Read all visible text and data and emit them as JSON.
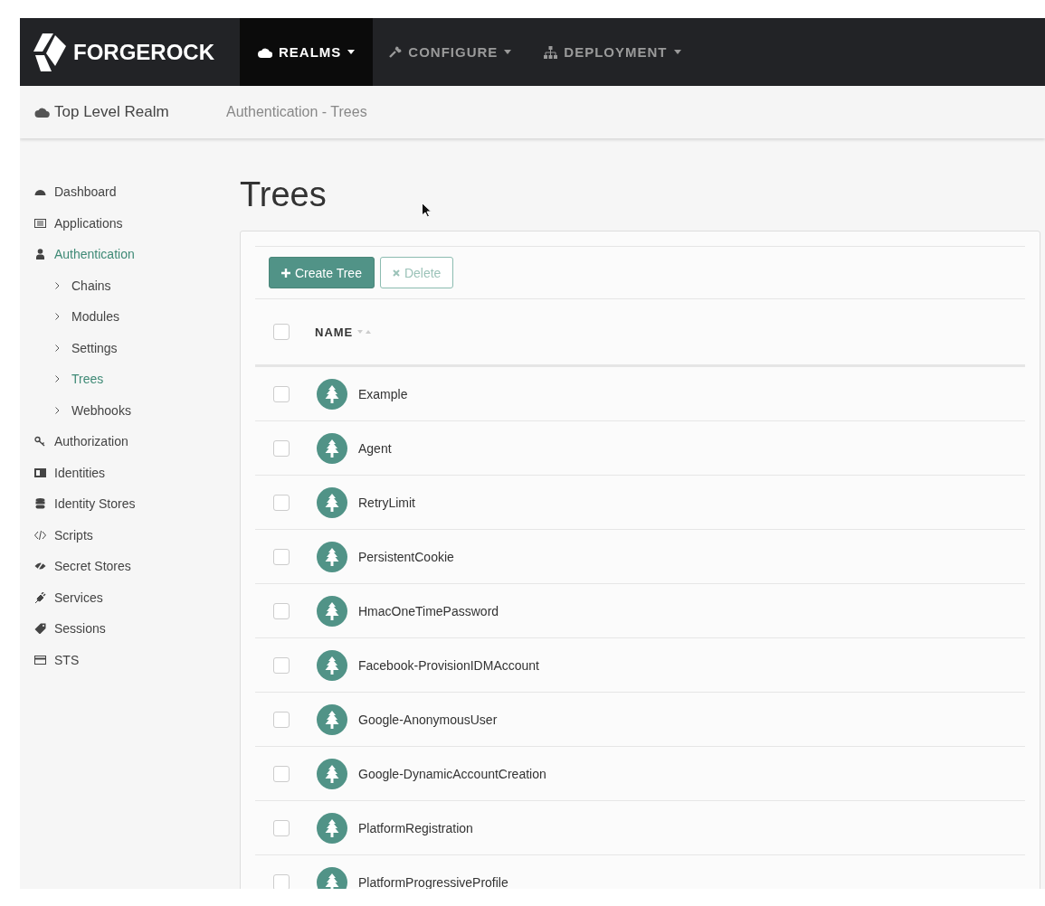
{
  "navbar": {
    "brand": "FORGEROCK",
    "menus": [
      {
        "label": "REALMS",
        "selected": true
      },
      {
        "label": "CONFIGURE",
        "selected": false
      },
      {
        "label": "DEPLOYMENT",
        "selected": false
      }
    ]
  },
  "subheader": {
    "realm": "Top Level Realm",
    "breadcrumb": "Authentication - Trees"
  },
  "sidebar": {
    "items": [
      {
        "label": "Dashboard",
        "selected": false
      },
      {
        "label": "Applications",
        "selected": false
      },
      {
        "label": "Authentication",
        "selected": true,
        "children": [
          {
            "label": "Chains",
            "selected": false
          },
          {
            "label": "Modules",
            "selected": false
          },
          {
            "label": "Settings",
            "selected": false
          },
          {
            "label": "Trees",
            "selected": true
          },
          {
            "label": "Webhooks",
            "selected": false
          }
        ]
      },
      {
        "label": "Authorization",
        "selected": false
      },
      {
        "label": "Identities",
        "selected": false
      },
      {
        "label": "Identity Stores",
        "selected": false
      },
      {
        "label": "Scripts",
        "selected": false
      },
      {
        "label": "Secret Stores",
        "selected": false
      },
      {
        "label": "Services",
        "selected": false
      },
      {
        "label": "Sessions",
        "selected": false
      },
      {
        "label": "STS",
        "selected": false
      }
    ]
  },
  "page_title": "Trees",
  "toolbar": {
    "create": "Create Tree",
    "delete": "Delete",
    "delete_disabled": true
  },
  "table": {
    "column": "NAME",
    "header_checked": false,
    "rows": [
      {
        "name": "Example",
        "checked": false
      },
      {
        "name": "Agent",
        "checked": false
      },
      {
        "name": "RetryLimit",
        "checked": false
      },
      {
        "name": "PersistentCookie",
        "checked": false
      },
      {
        "name": "HmacOneTimePassword",
        "checked": false
      },
      {
        "name": "Facebook-ProvisionIDMAccount",
        "checked": false
      },
      {
        "name": "Google-AnonymousUser",
        "checked": false
      },
      {
        "name": "Google-DynamicAccountCreation",
        "checked": false
      },
      {
        "name": "PlatformRegistration",
        "checked": false
      },
      {
        "name": "PlatformProgressiveProfile",
        "checked": false
      }
    ]
  }
}
